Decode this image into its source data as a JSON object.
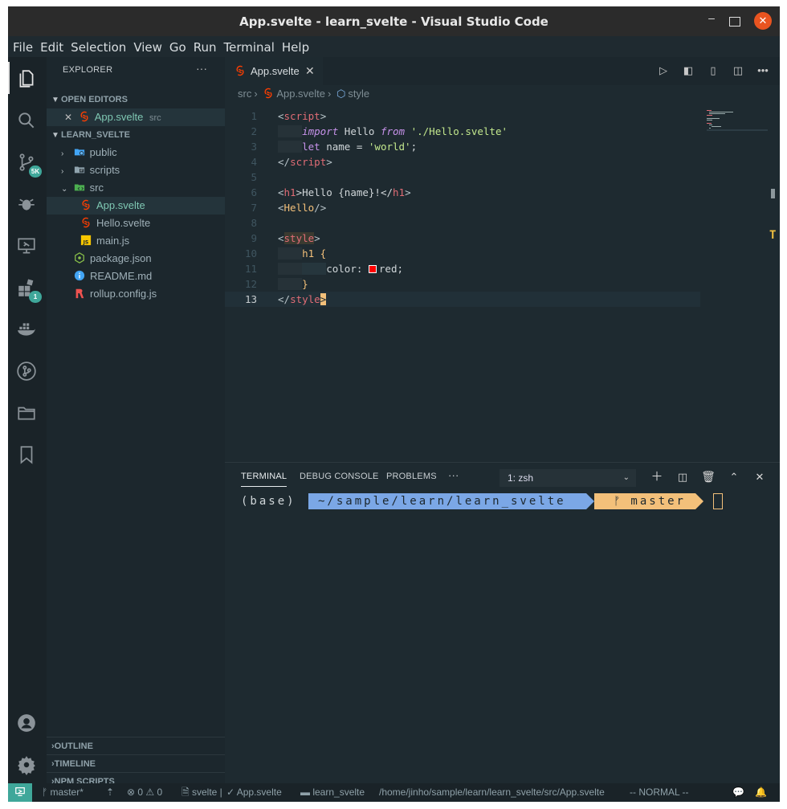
{
  "title": "App.svelte - learn_svelte - Visual Studio Code",
  "menu": [
    "File",
    "Edit",
    "Selection",
    "View",
    "Go",
    "Run",
    "Terminal",
    "Help"
  ],
  "activity": {
    "scm_badge": "5K",
    "extensions_badge": "1"
  },
  "sidebar": {
    "header": "EXPLORER",
    "more": "···",
    "open_editors_label": "OPEN EDITORS",
    "open_editor_file": "App.svelte",
    "open_editor_dir": "src",
    "project_label": "LEARN_SVELTE",
    "tree": [
      {
        "name": "public",
        "kind": "folder"
      },
      {
        "name": "scripts",
        "kind": "folder"
      },
      {
        "name": "src",
        "kind": "folder-open"
      },
      {
        "name": "App.svelte",
        "kind": "svelte"
      },
      {
        "name": "Hello.svelte",
        "kind": "svelte"
      },
      {
        "name": "main.js",
        "kind": "js"
      },
      {
        "name": "package.json",
        "kind": "json"
      },
      {
        "name": "README.md",
        "kind": "info"
      },
      {
        "name": "rollup.config.js",
        "kind": "rollup"
      }
    ],
    "outline": "OUTLINE",
    "timeline": "TIMELINE",
    "npm_scripts": "NPM SCRIPTS"
  },
  "editor": {
    "tab_label": "App.svelte",
    "tab_close": "✕",
    "breadcrumb": [
      "src",
      "App.svelte",
      "style"
    ],
    "line_numbers": [
      "1",
      "2",
      "3",
      "4",
      "5",
      "6",
      "7",
      "8",
      "9",
      "10",
      "11",
      "12",
      "13"
    ],
    "code": {
      "l1_open": "<",
      "l1_tag": "script",
      "l1_close": ">",
      "l2_kw1": "import",
      "l2_mid": " Hello ",
      "l2_kw2": "from",
      "l2_str": "'./Hello.svelte'",
      "l3_kw": "let",
      "l3_mid": " name = ",
      "l3_str": "'world'",
      "l3_end": ";",
      "l4_open": "</",
      "l4_tag": "script",
      "l4_close": ">",
      "l6_open": "<",
      "l6_tag": "h1",
      "l6_text": ">Hello {name}!</",
      "l6_tag2": "h1",
      "l6_close": ">",
      "l7_open": "<",
      "l7_tag": "Hello",
      "l7_close": "/>",
      "l9_open": "<",
      "l9_tag": "style",
      "l9_close": ">",
      "l10": "h1 {",
      "l11_prop": "color: ",
      "l11_val": "red;",
      "l12": "}",
      "l13_open": "</",
      "l13_tag": "style",
      "l13_close": ">"
    }
  },
  "panel": {
    "tabs": [
      "TERMINAL",
      "DEBUG CONSOLE",
      "PROBLEMS",
      "···"
    ],
    "shell_select": "1: zsh",
    "terminal": {
      "env": "(base)",
      "path": "~/sample/learn/learn_svelte",
      "branch_icon": "ᚠ",
      "branch": "master"
    }
  },
  "statusbar": {
    "branch": "master*",
    "errors": "0",
    "warnings": "0",
    "lang": "svelte |",
    "file": "App.svelte",
    "folder": "learn_svelte",
    "path": "/home/jinho/sample/learn/learn_svelte/src/App.svelte",
    "mode": "-- NORMAL --"
  },
  "colors": {
    "accent": "#3fa79a",
    "svelte": "#ff3e00",
    "tag": "#e06c75",
    "keyword": "#c792ea",
    "string": "#c3e88d",
    "prompt_path": "#7ba7e6",
    "prompt_git": "#f3c07a"
  }
}
